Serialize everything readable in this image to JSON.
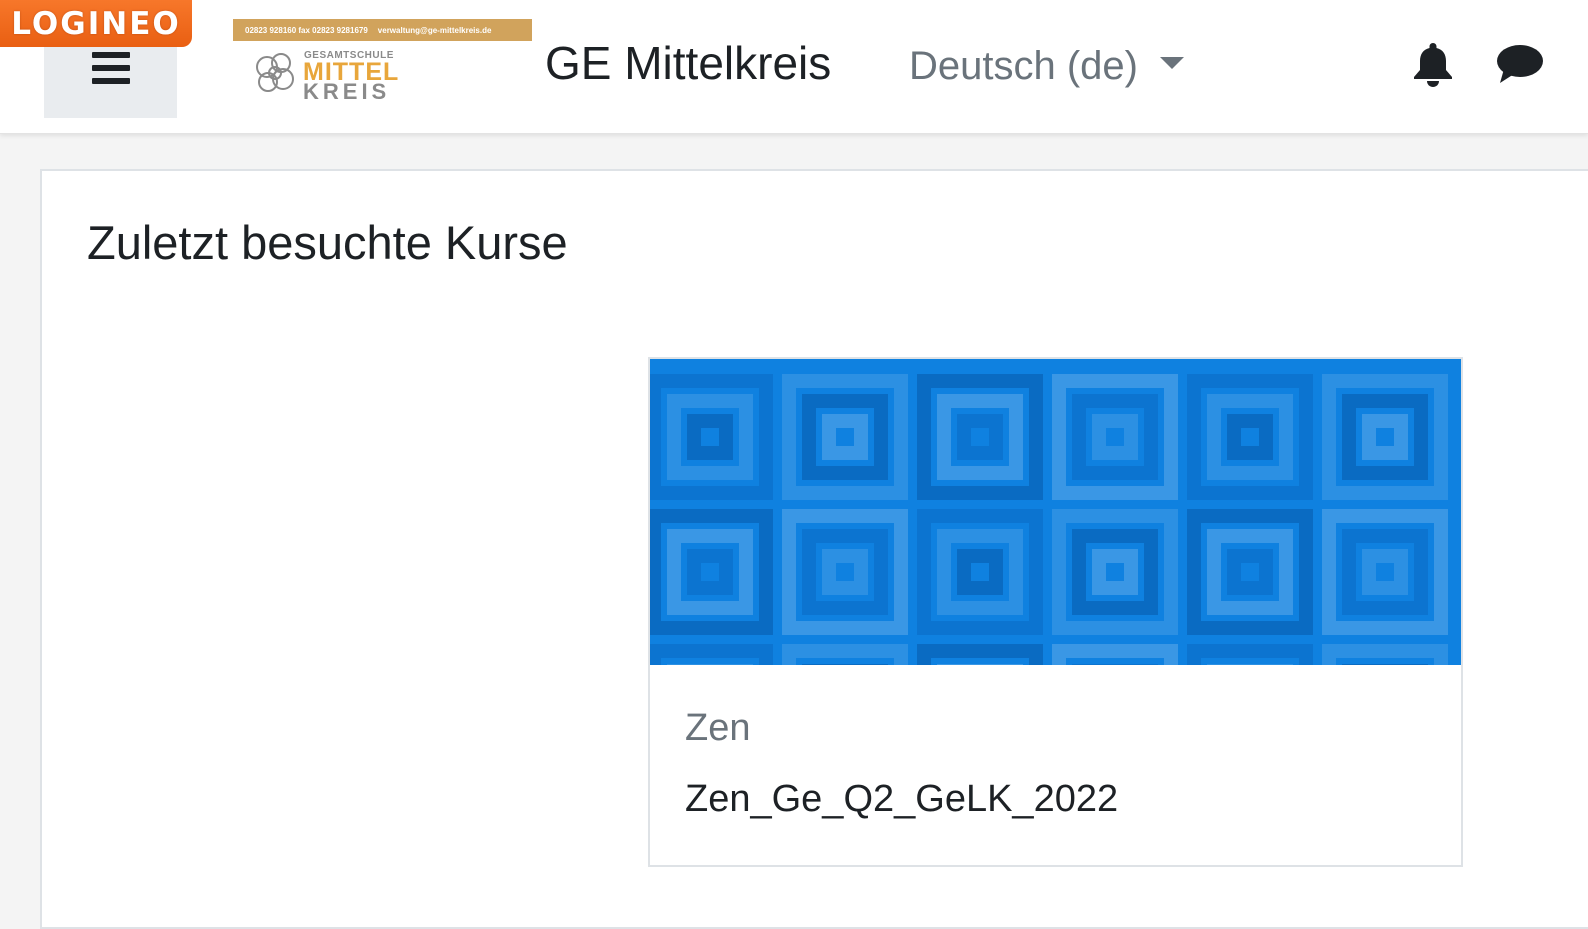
{
  "header": {
    "badge_text": "LOGINEO",
    "menu_button_label": "Menu",
    "site_name": "GE Mittelkreis",
    "school_logo": {
      "phone_text": "02823 928160 fax 02823 9281679",
      "email_text": "verwaltung@ge-mittelkreis.de",
      "line_small": "GESAMTSCHULE",
      "line_mittel": "MITTEL",
      "line_kreis": "KREIS"
    },
    "language": "Deutsch (de)",
    "icons": {
      "notifications": "bell-icon",
      "messages": "chat-icon"
    }
  },
  "main": {
    "section_title": "Zuletzt besuchte Kurse",
    "courses": [
      {
        "category": "Zen",
        "name": "Zen_Ge_Q2_GeLK_2022"
      }
    ]
  },
  "colors": {
    "badge": "#f26a1b",
    "course_image": "#0f81e0",
    "logo_strip": "#d1a35c",
    "logo_accent": "#e8a63b"
  }
}
